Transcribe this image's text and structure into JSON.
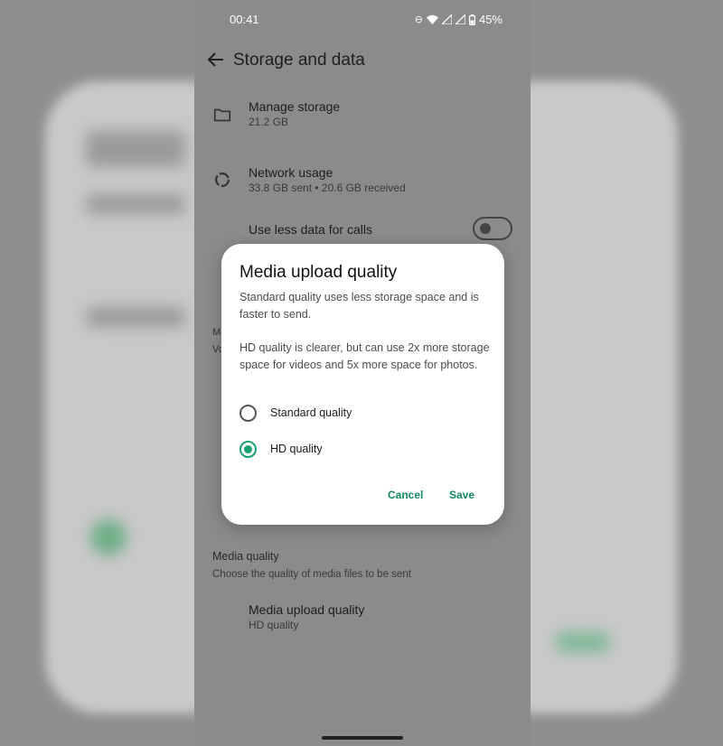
{
  "status_bar": {
    "time": "00:41",
    "battery": "45%",
    "icons": [
      "dnd-icon",
      "wifi-icon",
      "signal-icon",
      "signal-icon",
      "battery-icon"
    ]
  },
  "app_bar": {
    "title": "Storage and data",
    "back_icon": "back-arrow-icon"
  },
  "settings": {
    "manage_storage": {
      "title": "Manage storage",
      "subtitle": "21.2 GB",
      "icon": "folder-icon"
    },
    "network_usage": {
      "title": "Network usage",
      "subtitle": "33.8 GB sent • 20.6 GB received",
      "icon": "data-usage-icon"
    },
    "use_less_data": {
      "title": "Use less data for calls",
      "enabled": false
    },
    "partial_section_head": "M",
    "partial_section_sub": "Vo",
    "media_quality": {
      "header": "Media quality",
      "description": "Choose the quality of media files to be sent",
      "upload_title": "Media upload quality",
      "upload_value": "HD quality"
    }
  },
  "dialog": {
    "title": "Media upload quality",
    "paragraph1": "Standard quality uses less storage space and is faster to send.",
    "paragraph2": "HD quality is clearer, but can use 2x more storage space for videos and 5x more space for photos.",
    "options": [
      {
        "label": "Standard quality",
        "selected": false
      },
      {
        "label": "HD quality",
        "selected": true
      }
    ],
    "cancel_label": "Cancel",
    "save_label": "Save"
  },
  "colors": {
    "accent": "#1aa16e",
    "button_text": "#128a5c",
    "scrim": "#8b8b8b"
  }
}
